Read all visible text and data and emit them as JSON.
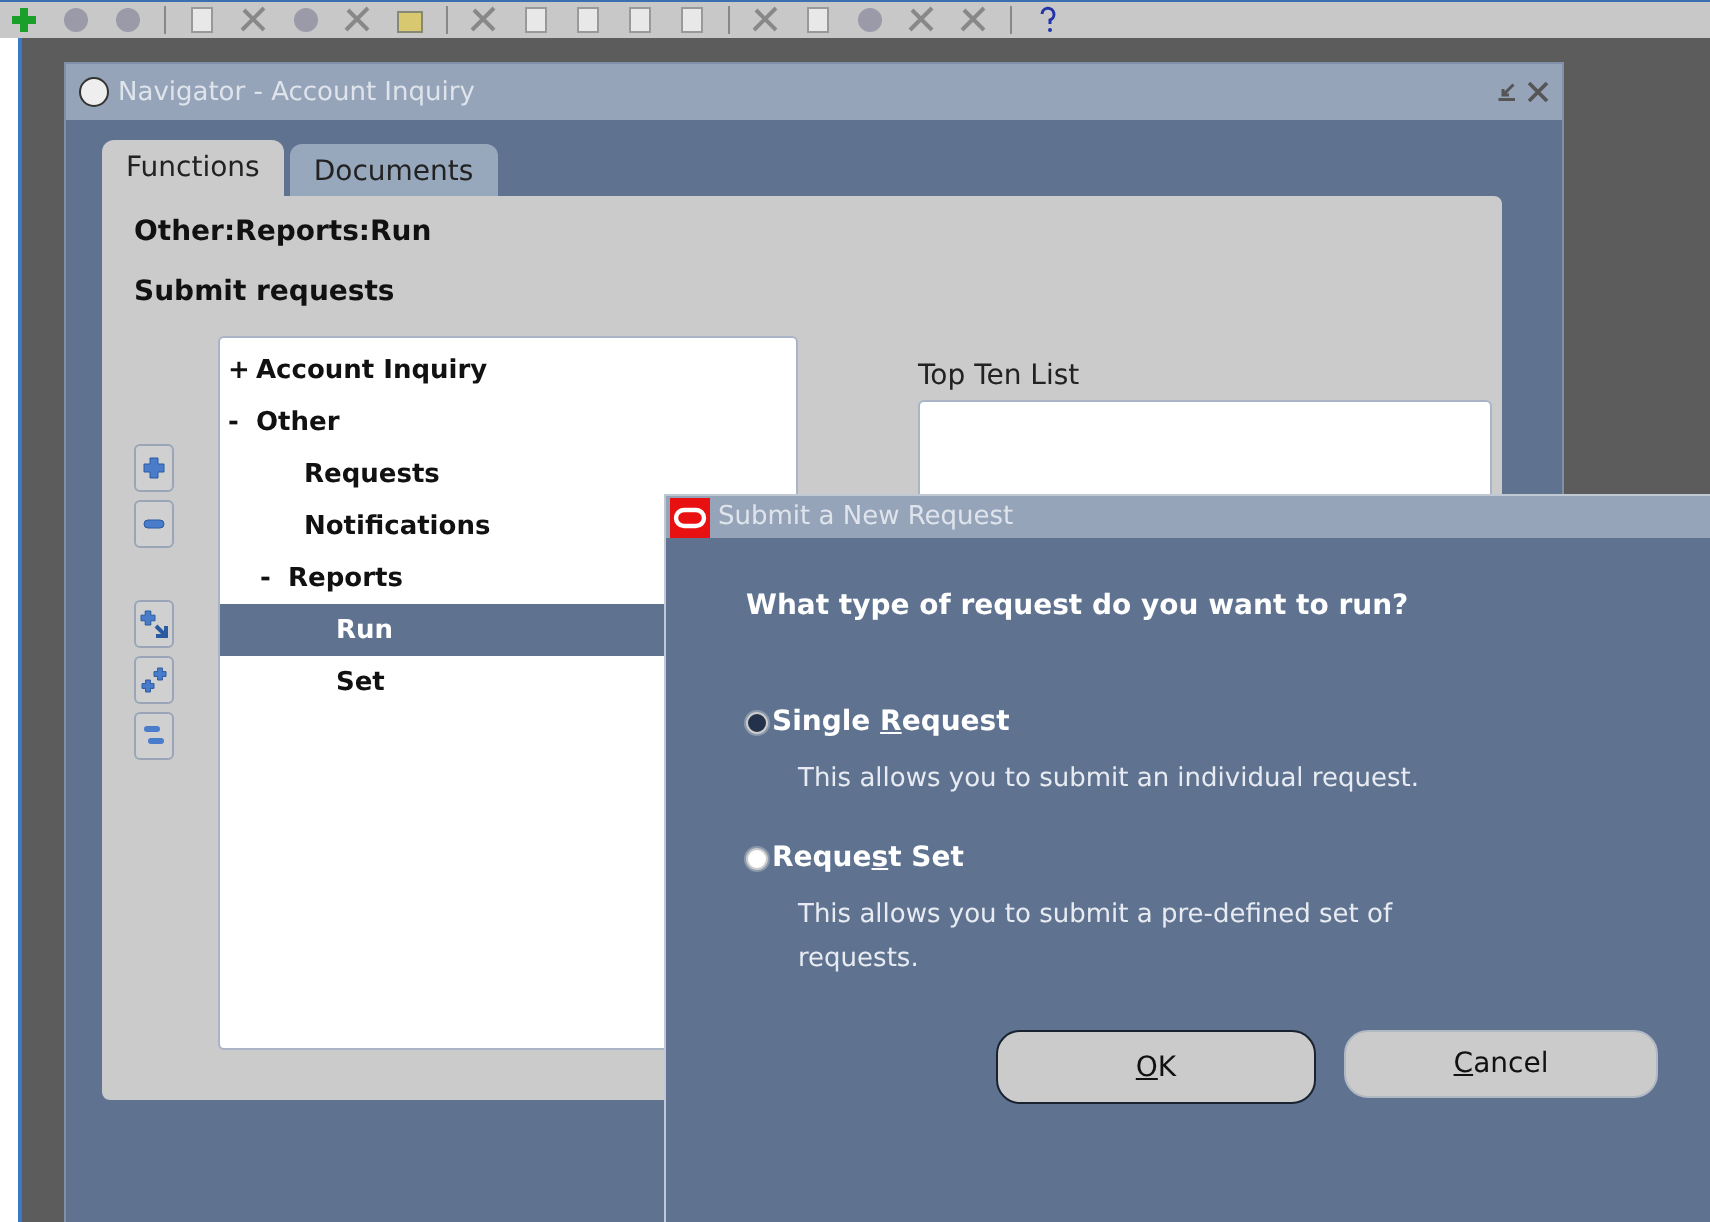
{
  "navigator": {
    "title": "Navigator - Account Inquiry",
    "tabs": [
      {
        "label": "Functions",
        "selected": true
      },
      {
        "label": "Documents",
        "selected": false
      }
    ],
    "path": "Other:Reports:Run",
    "subtitle": "Submit requests",
    "tree": [
      {
        "sign": "+",
        "label": "Account Inquiry",
        "selected": false
      },
      {
        "sign": "-",
        "label": "Other",
        "selected": false,
        "children": [
          {
            "label": "Requests",
            "selected": false
          },
          {
            "label": "Notifications",
            "selected": false
          },
          {
            "sign": "-",
            "label": "Reports",
            "selected": false,
            "children": [
              {
                "label": "Run",
                "selected": true
              },
              {
                "label": "Set",
                "selected": false
              }
            ]
          }
        ]
      }
    ],
    "top_ten_label": "Top Ten List"
  },
  "dialog": {
    "title": "Submit a New Request",
    "question": "What type of request do you want to run?",
    "options": [
      {
        "before": "Single ",
        "key": "R",
        "after": "equest",
        "description": "This allows you to submit an individual request.",
        "selected": true
      },
      {
        "before": "Reque",
        "key": "s",
        "after": "t Set",
        "description": "This allows you to submit a pre-defined set of requests.",
        "selected": false
      }
    ],
    "buttons": [
      {
        "key": "O",
        "after": "K",
        "default": true
      },
      {
        "key": "C",
        "after": "ancel",
        "default": false
      }
    ]
  }
}
